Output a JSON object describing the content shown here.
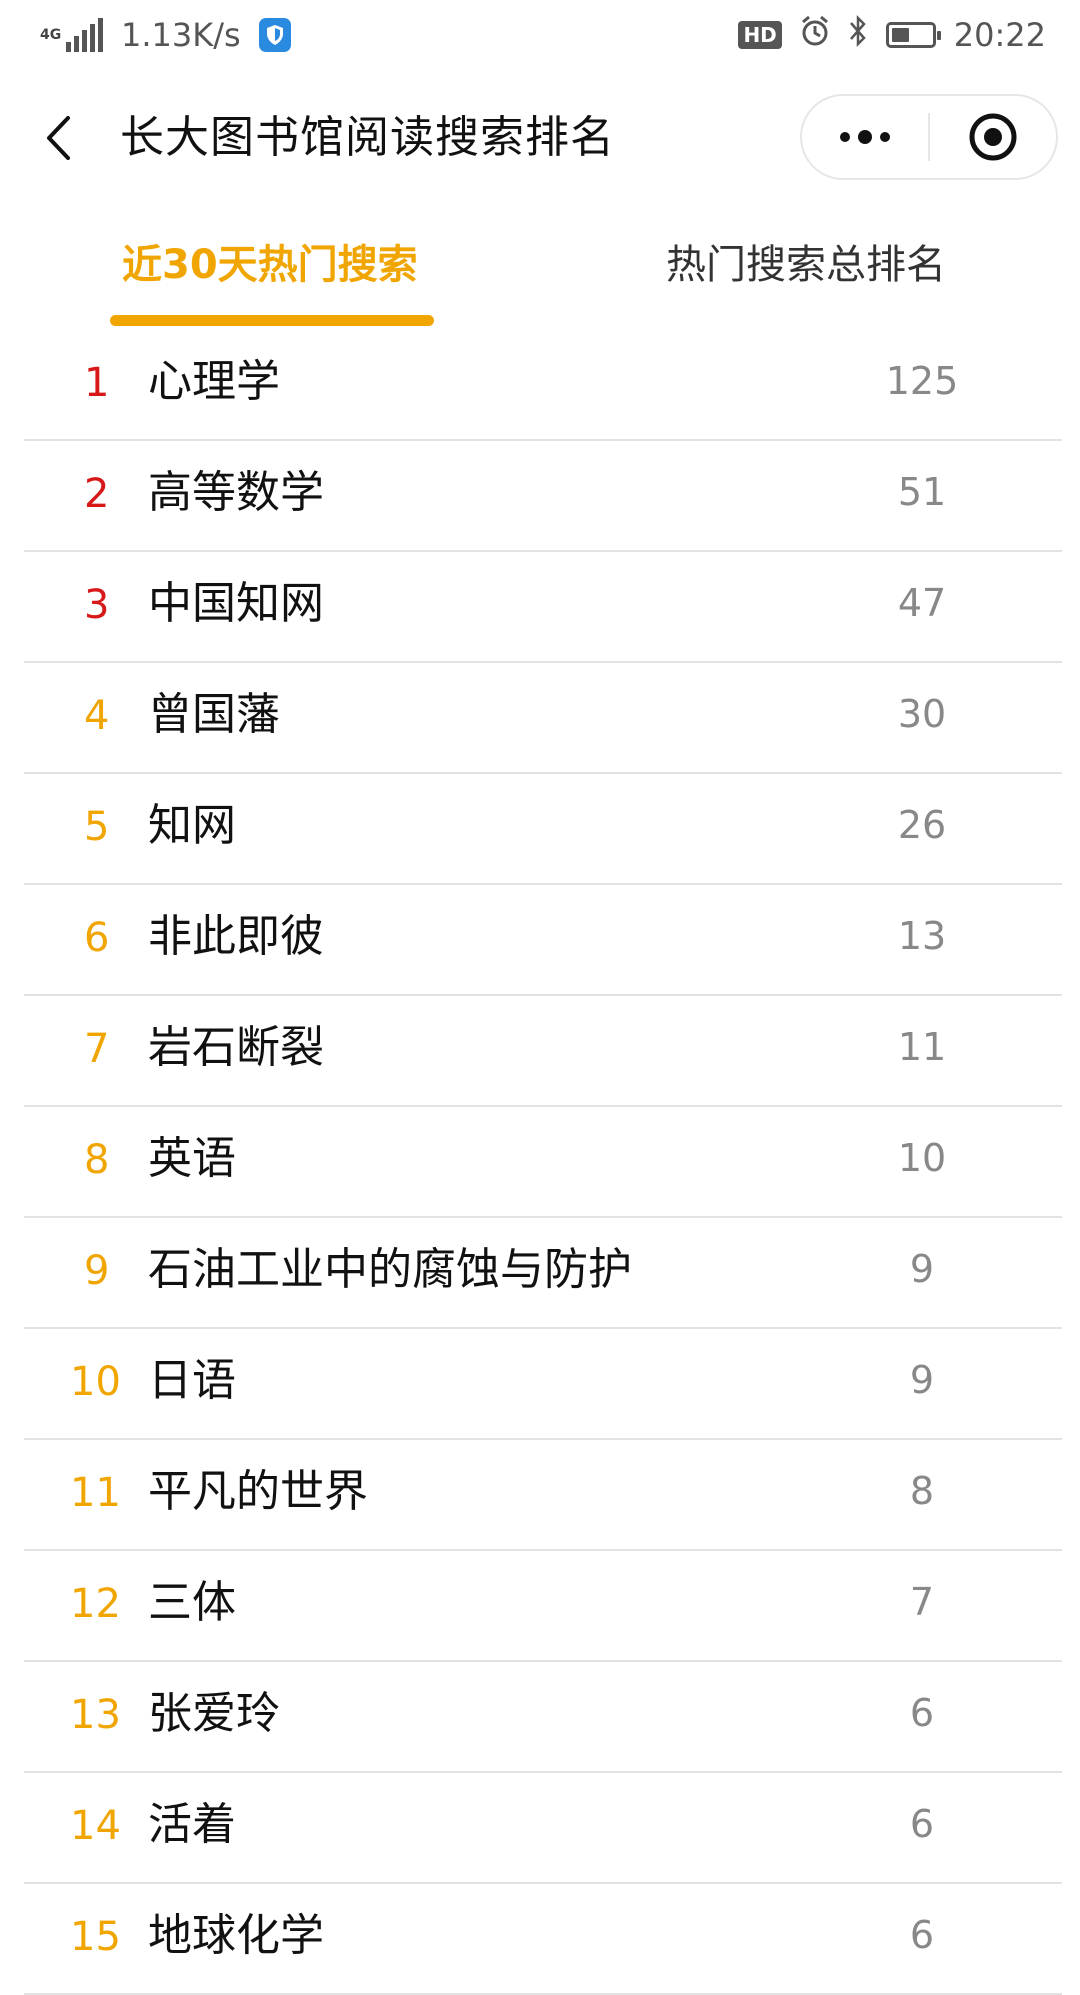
{
  "status_bar": {
    "network_type": "4G",
    "network_speed": "1.13K/s",
    "hd_badge": "HD",
    "time": "20:22",
    "battery_level_pct": 45,
    "icons": [
      "signal-icon",
      "shield-app-icon",
      "hd-icon",
      "alarm-icon",
      "bluetooth-icon",
      "battery-icon"
    ]
  },
  "header": {
    "title": "长大图书馆阅读搜索排名",
    "back_icon": "chevron-left-icon",
    "more_icon": "more-dots-icon",
    "close_icon": "target-close-icon"
  },
  "tabs": [
    {
      "label": "近30天热门搜索",
      "active": true
    },
    {
      "label": "热门搜索总排名",
      "active": false
    }
  ],
  "colors": {
    "accent": "#f0a500",
    "top_rank": "#d71818",
    "other_rank": "#f0a500",
    "count": "#888888",
    "divider": "#e3e3e3"
  },
  "list": [
    {
      "rank": "1",
      "name": "心理学",
      "count": "125"
    },
    {
      "rank": "2",
      "name": "高等数学",
      "count": "51"
    },
    {
      "rank": "3",
      "name": "中国知网",
      "count": "47"
    },
    {
      "rank": "4",
      "name": "曾国藩",
      "count": "30"
    },
    {
      "rank": "5",
      "name": "知网",
      "count": "26"
    },
    {
      "rank": "6",
      "name": "非此即彼",
      "count": "13"
    },
    {
      "rank": "7",
      "name": "岩石断裂",
      "count": "11"
    },
    {
      "rank": "8",
      "name": "英语",
      "count": "10"
    },
    {
      "rank": "9",
      "name": "石油工业中的腐蚀与防护",
      "count": "9"
    },
    {
      "rank": "10",
      "name": "日语",
      "count": "9"
    },
    {
      "rank": "11",
      "name": "平凡的世界",
      "count": "8"
    },
    {
      "rank": "12",
      "name": "三体",
      "count": "7"
    },
    {
      "rank": "13",
      "name": "张爱玲",
      "count": "6"
    },
    {
      "rank": "14",
      "name": "活着",
      "count": "6"
    },
    {
      "rank": "15",
      "name": "地球化学",
      "count": "6"
    }
  ]
}
